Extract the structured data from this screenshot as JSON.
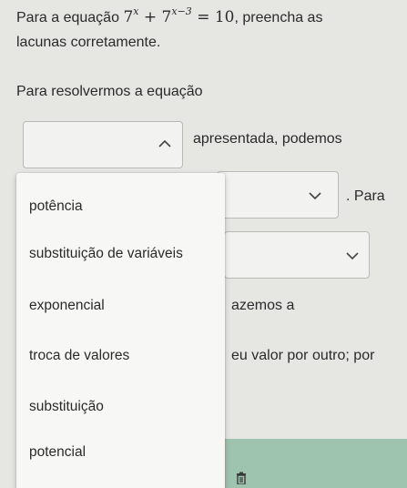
{
  "question": {
    "prefix": "Para a equação",
    "equation": {
      "term1_base": "7",
      "term1_exp": "x",
      "plus": "+",
      "term2_base": "7",
      "term2_exp": "x−3",
      "equals": "=",
      "rhs": "10"
    },
    "suffix": ", preencha as",
    "line2": "lacunas corretamente."
  },
  "body": {
    "line3": "Para resolvermos a equação",
    "line4_after_blank": "apresentada, podemos",
    "line5_after_blank": ". Para",
    "line7_fragment": "azemos a",
    "line8_fragment": "eu valor por outro; por"
  },
  "dropdown": {
    "open_state": "expanded",
    "options": [
      "potência",
      "substituição de variáveis",
      "exponencial",
      "troca de valores",
      "substituição",
      "potencial"
    ]
  },
  "icons": {
    "chevron_up": "chevron-up-icon",
    "chevron_down": "chevron-down-icon",
    "trash": "trash-icon"
  },
  "colors": {
    "background": "#e6e6e3",
    "menu_background": "#f7f7f5",
    "bottom_bar": "#9ec3ae",
    "text": "#2a2a2a"
  }
}
